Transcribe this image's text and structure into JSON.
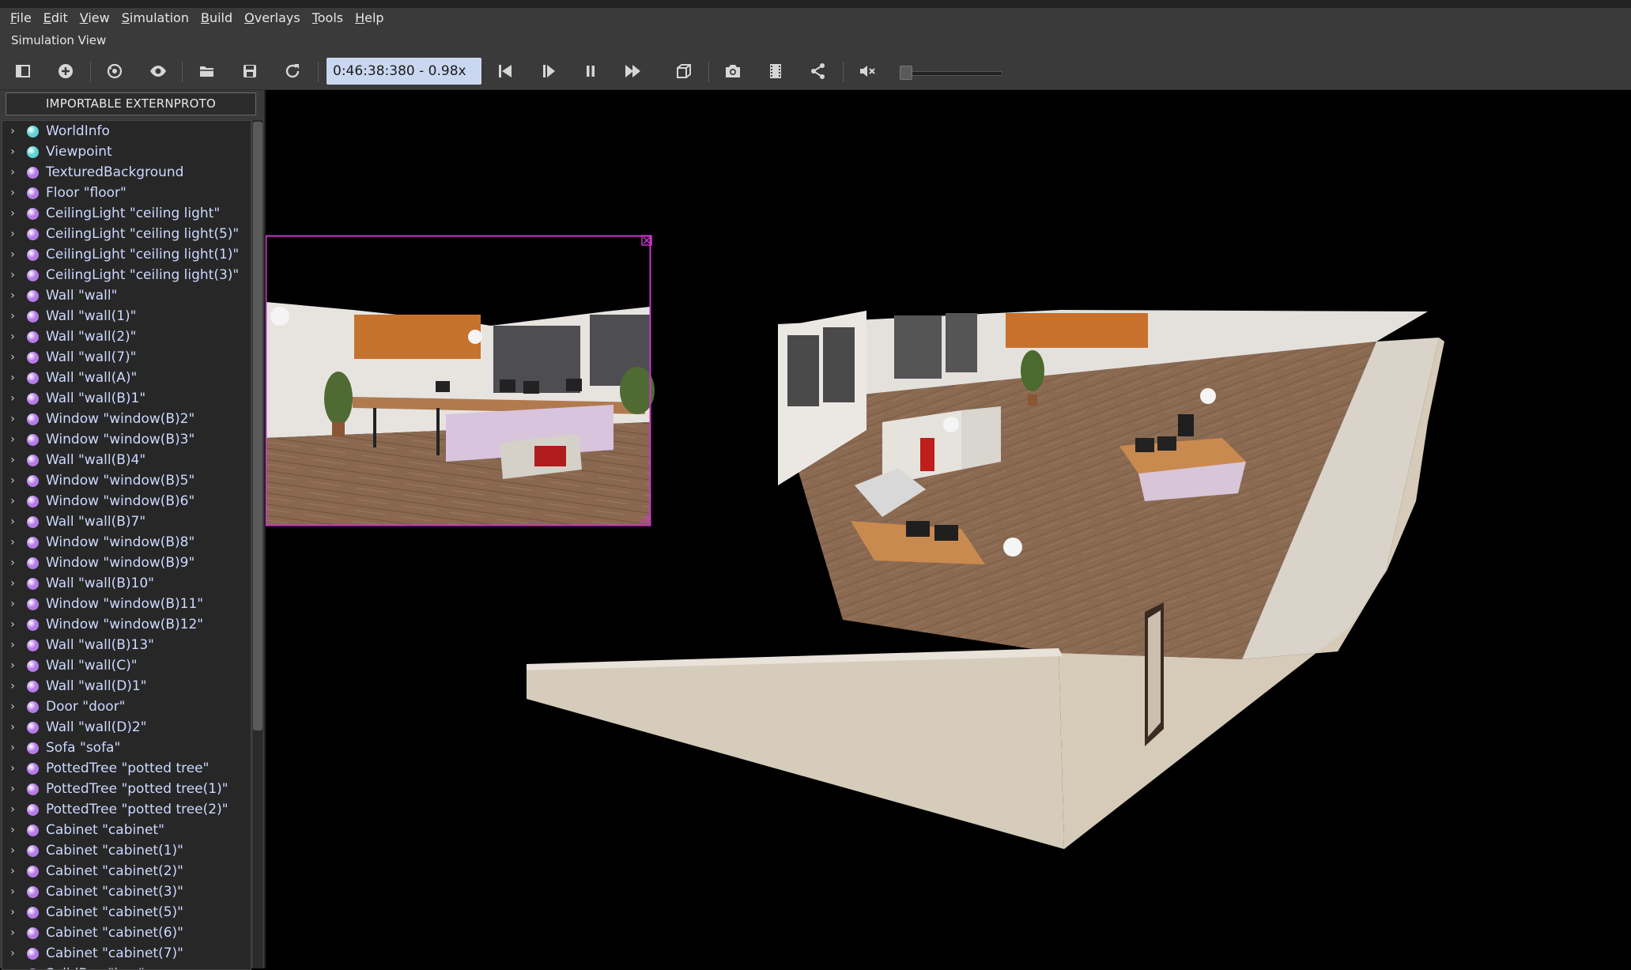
{
  "menu": {
    "items": [
      {
        "first": "F",
        "rest": "ile"
      },
      {
        "first": "E",
        "rest": "dit"
      },
      {
        "first": "V",
        "rest": "iew"
      },
      {
        "first": "S",
        "rest": "imulation"
      },
      {
        "first": "B",
        "rest": "uild"
      },
      {
        "first": "O",
        "rest": "verlays"
      },
      {
        "first": "T",
        "rest": "ools"
      },
      {
        "first": "H",
        "rest": "elp"
      }
    ]
  },
  "view_title": "Simulation View",
  "toolbar": {
    "time": "0:46:38:380",
    "separator": " - ",
    "speed": "0.98x",
    "volume_level": 0.0
  },
  "panel": {
    "importable_button": "IMPORTABLE EXTERNPROTO",
    "tree_items": [
      {
        "label": "WorldInfo",
        "color": "#5fd3d6"
      },
      {
        "label": "Viewpoint",
        "color": "#5fd3d6"
      },
      {
        "label": "TexturedBackground",
        "color": "#b57be8"
      },
      {
        "label": "Floor \"floor\"",
        "color": "#b57be8"
      },
      {
        "label": "CeilingLight \"ceiling light\"",
        "color": "#b57be8"
      },
      {
        "label": "CeilingLight \"ceiling light(5)\"",
        "color": "#b57be8"
      },
      {
        "label": "CeilingLight \"ceiling light(1)\"",
        "color": "#b57be8"
      },
      {
        "label": "CeilingLight \"ceiling light(3)\"",
        "color": "#b57be8"
      },
      {
        "label": "Wall \"wall\"",
        "color": "#b57be8"
      },
      {
        "label": "Wall \"wall(1)\"",
        "color": "#b57be8"
      },
      {
        "label": "Wall \"wall(2)\"",
        "color": "#b57be8"
      },
      {
        "label": "Wall \"wall(7)\"",
        "color": "#b57be8"
      },
      {
        "label": "Wall \"wall(A)\"",
        "color": "#b57be8"
      },
      {
        "label": "Wall \"wall(B)1\"",
        "color": "#b57be8"
      },
      {
        "label": "Window \"window(B)2\"",
        "color": "#b57be8"
      },
      {
        "label": "Window \"window(B)3\"",
        "color": "#b57be8"
      },
      {
        "label": "Wall \"wall(B)4\"",
        "color": "#b57be8"
      },
      {
        "label": "Window \"window(B)5\"",
        "color": "#b57be8"
      },
      {
        "label": "Window \"window(B)6\"",
        "color": "#b57be8"
      },
      {
        "label": "Wall \"wall(B)7\"",
        "color": "#b57be8"
      },
      {
        "label": "Window \"window(B)8\"",
        "color": "#b57be8"
      },
      {
        "label": "Window \"window(B)9\"",
        "color": "#b57be8"
      },
      {
        "label": "Wall \"wall(B)10\"",
        "color": "#b57be8"
      },
      {
        "label": "Window \"window(B)11\"",
        "color": "#b57be8"
      },
      {
        "label": "Window \"window(B)12\"",
        "color": "#b57be8"
      },
      {
        "label": "Wall \"wall(B)13\"",
        "color": "#b57be8"
      },
      {
        "label": "Wall \"wall(C)\"",
        "color": "#b57be8"
      },
      {
        "label": "Wall \"wall(D)1\"",
        "color": "#b57be8"
      },
      {
        "label": "Door \"door\"",
        "color": "#b57be8"
      },
      {
        "label": "Wall \"wall(D)2\"",
        "color": "#b57be8"
      },
      {
        "label": "Sofa \"sofa\"",
        "color": "#b57be8"
      },
      {
        "label": "PottedTree \"potted tree\"",
        "color": "#b57be8"
      },
      {
        "label": "PottedTree \"potted tree(1)\"",
        "color": "#b57be8"
      },
      {
        "label": "PottedTree \"potted tree(2)\"",
        "color": "#b57be8"
      },
      {
        "label": "Cabinet \"cabinet\"",
        "color": "#b57be8"
      },
      {
        "label": "Cabinet \"cabinet(1)\"",
        "color": "#b57be8"
      },
      {
        "label": "Cabinet \"cabinet(2)\"",
        "color": "#b57be8"
      },
      {
        "label": "Cabinet \"cabinet(3)\"",
        "color": "#b57be8"
      },
      {
        "label": "Cabinet \"cabinet(5)\"",
        "color": "#b57be8"
      },
      {
        "label": "Cabinet \"cabinet(6)\"",
        "color": "#b57be8"
      },
      {
        "label": "Cabinet \"cabinet(7)\"",
        "color": "#b57be8"
      },
      {
        "label": "SolidBox \"box\"",
        "color": "#b57be8"
      }
    ]
  },
  "colors": {
    "accent_timebox": "#c9d8f0",
    "overlay_border": "#cc33cc",
    "tree_label": "#cdd8ff"
  },
  "icons": [
    "toggle-panel-icon",
    "add-node-icon",
    "reset-view-icon",
    "eye-icon",
    "open-folder-icon",
    "save-icon",
    "reload-icon",
    "step-back-icon",
    "step-icon",
    "pause-icon",
    "fast-forward-icon",
    "cube-icon",
    "camera-icon",
    "film-icon",
    "share-icon",
    "mute-icon"
  ]
}
